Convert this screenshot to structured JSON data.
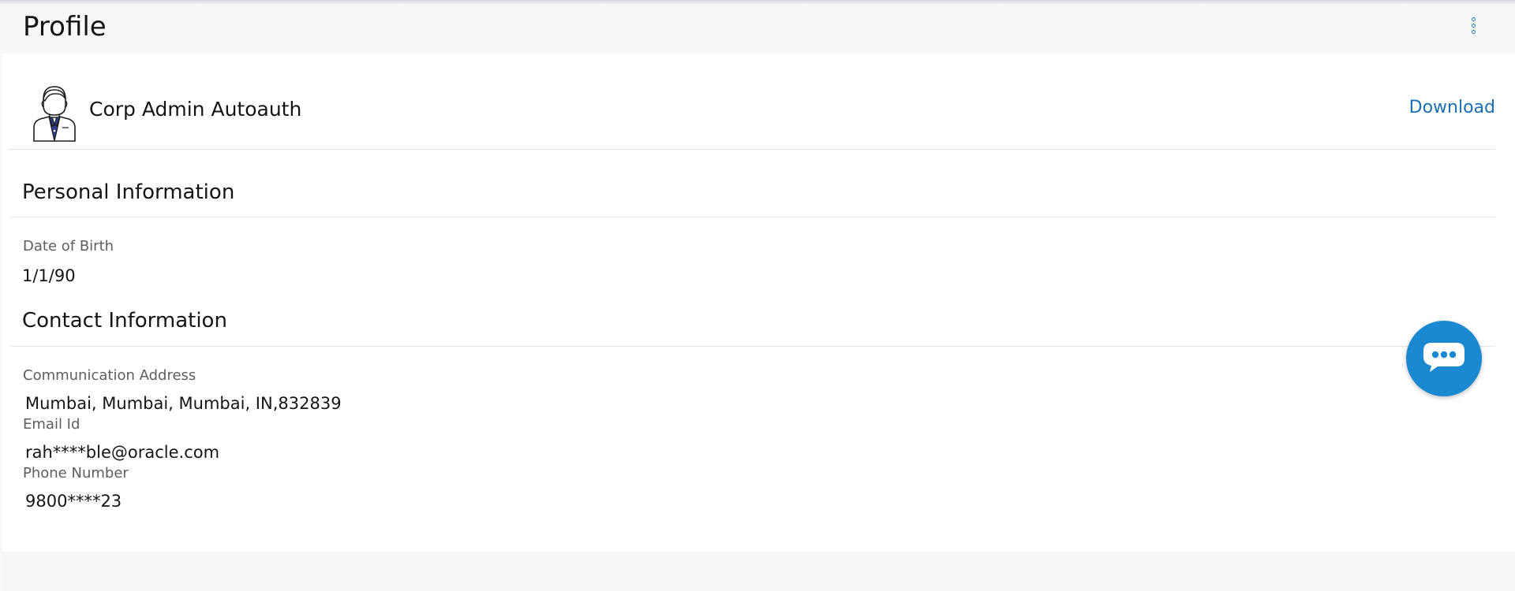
{
  "header": {
    "title": "Profile",
    "more_icon": "more-vertical-icon"
  },
  "profile": {
    "avatar_icon": "user-avatar-icon",
    "name": "Corp Admin Autoauth",
    "download_label": "Download"
  },
  "personal_information": {
    "title": "Personal Information",
    "fields": [
      {
        "label": "Date of Birth",
        "value": "1/1/90"
      }
    ]
  },
  "contact_information": {
    "title": "Contact Information",
    "fields": [
      {
        "label": "Communication Address",
        "value": "Mumbai, Mumbai, Mumbai, IN,832839"
      },
      {
        "label": "Email Id",
        "value": "rah****ble@oracle.com"
      },
      {
        "label": "Phone Number",
        "value": "9800****23"
      }
    ]
  },
  "chat": {
    "icon": "chat-bubble-icon"
  },
  "colors": {
    "accent": "#1a6fb5",
    "chat_button": "#1a89d2",
    "background": "#f8f8f8",
    "panel": "#ffffff"
  }
}
